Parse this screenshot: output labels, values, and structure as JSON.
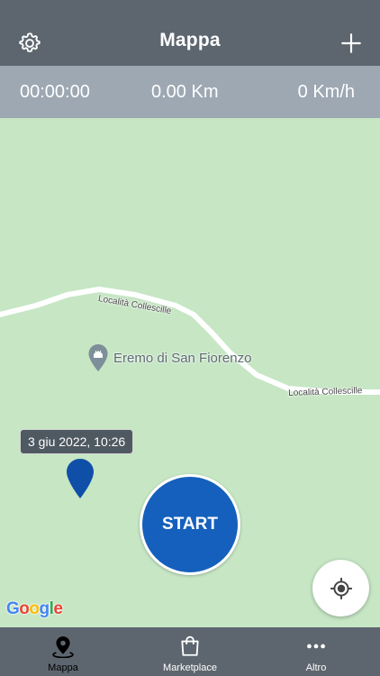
{
  "header": {
    "title": "Mappa"
  },
  "stats": {
    "time": "00:00:00",
    "distance": "0.00 Km",
    "speed": "0 Km/h"
  },
  "map": {
    "road_label_1": "Località Collescille",
    "road_label_2": "Località Collescille",
    "poi_name": "Eremo di San Fiorenzo",
    "marker_tooltip": "3 giu 2022, 10:26",
    "start_label": "START",
    "attribution": [
      "G",
      "o",
      "o",
      "g",
      "l",
      "e"
    ]
  },
  "tabs": [
    {
      "label": "Mappa",
      "icon": "map-pin-icon",
      "active": true
    },
    {
      "label": "Marketplace",
      "icon": "shopping-bag-icon",
      "active": false
    },
    {
      "label": "Altro",
      "icon": "more-dots-icon",
      "active": false
    }
  ],
  "colors": {
    "header_bg": "#5d666f",
    "stats_bg": "#9da8b3",
    "map_bg": "#c6e6c4",
    "start_button": "#1560bd",
    "marker": "#0f4fa8"
  }
}
